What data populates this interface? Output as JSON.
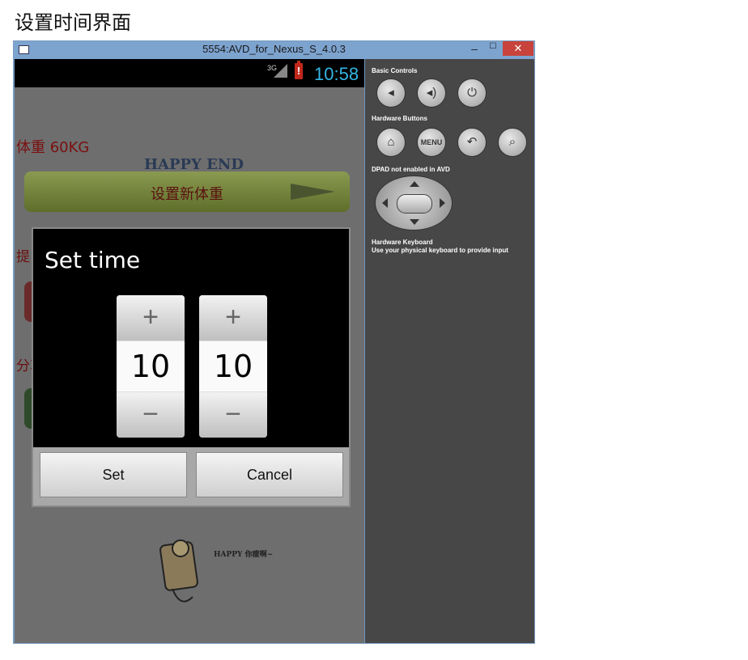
{
  "page": {
    "heading": "设置时间界面"
  },
  "window": {
    "title": "5554:AVD_for_Nexus_S_4.0.3",
    "min": "‒",
    "max": "☐",
    "close": "✕"
  },
  "statusbar": {
    "network": "3G",
    "time": "10:58",
    "battery_alert": "!"
  },
  "app": {
    "weight_label": "体重 60KG",
    "happy_end": "HAPPY END",
    "set_weight_button": "设置新体重",
    "reminder_label": "提",
    "share_label": "分享设置",
    "cartoon_caption": "HAPPY 你瘦啊~"
  },
  "dialog": {
    "title": "Set time",
    "hour": "10",
    "minute": "10",
    "increment": "+",
    "decrement": "−",
    "set_button": "Set",
    "cancel_button": "Cancel"
  },
  "controls": {
    "basic_label": "Basic Controls",
    "hardware_label": "Hardware Buttons",
    "dpad_label": "DPAD not enabled in AVD",
    "keyboard_label": "Hardware Keyboard",
    "keyboard_hint": "Use your physical keyboard to provide input",
    "menu_text": "MENU"
  },
  "colors": {
    "clock": "#33b5e5",
    "battery": "#c0281c",
    "close": "#c7433b"
  }
}
